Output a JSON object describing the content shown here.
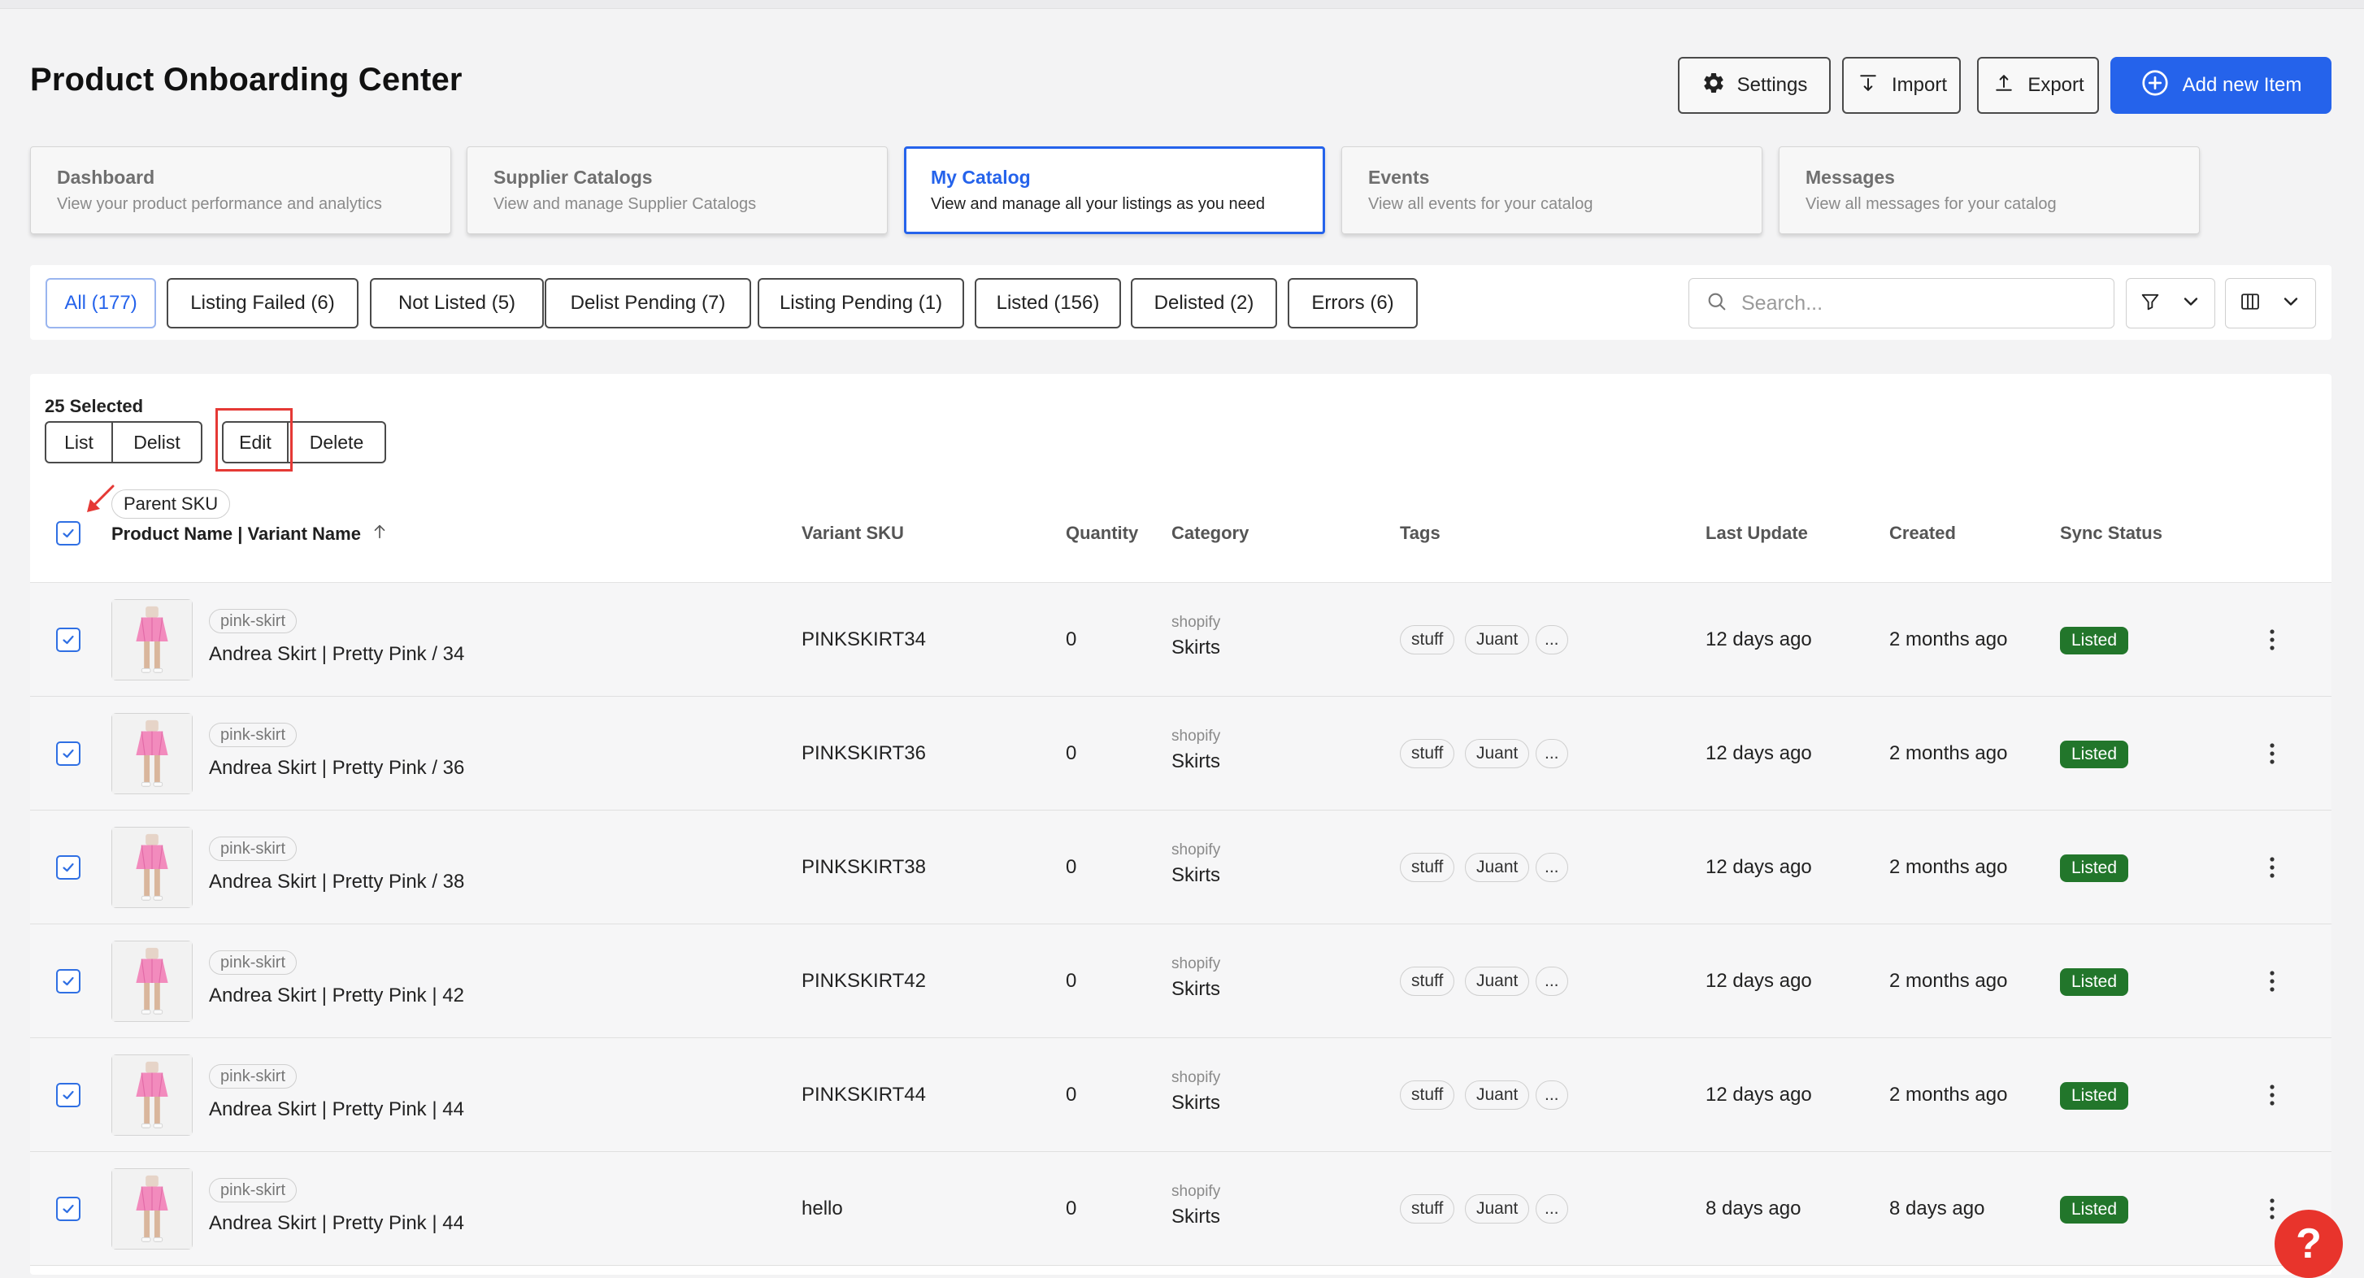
{
  "page_title": "Product Onboarding Center",
  "header": {
    "settings": "Settings",
    "import": "Import",
    "export": "Export",
    "add_new_item": "Add new Item"
  },
  "nav_cards": [
    {
      "title": "Dashboard",
      "subtitle": "View your product performance and analytics"
    },
    {
      "title": "Supplier Catalogs",
      "subtitle": "View and manage Supplier Catalogs"
    },
    {
      "title": "My Catalog",
      "subtitle": "View and manage all your listings as you need"
    },
    {
      "title": "Events",
      "subtitle": "View all events for your catalog"
    },
    {
      "title": "Messages",
      "subtitle": "View all messages for your catalog"
    }
  ],
  "filters": [
    {
      "label": "All (177)",
      "active": true
    },
    {
      "label": "Listing Failed (6)"
    },
    {
      "label": "Not Listed (5)"
    },
    {
      "label": "Delist Pending (7)"
    },
    {
      "label": "Listing Pending (1)"
    },
    {
      "label": "Listed (156)"
    },
    {
      "label": "Delisted (2)"
    },
    {
      "label": "Errors (6)"
    }
  ],
  "search": {
    "placeholder": "Search..."
  },
  "bulk": {
    "selected": "25 Selected",
    "list": "List",
    "delist": "Delist",
    "edit": "Edit",
    "delete": "Delete"
  },
  "columns": {
    "parent_sku": "Parent SKU",
    "product": "Product Name | Variant Name",
    "variant_sku": "Variant SKU",
    "quantity": "Quantity",
    "category": "Category",
    "tags": "Tags",
    "last_update": "Last Update",
    "created": "Created",
    "sync_status": "Sync Status"
  },
  "rows": [
    {
      "parent_sku": "pink-skirt",
      "name": "Andrea Skirt | Pretty Pink / 34",
      "variant_sku": "PINKSKIRT34",
      "quantity": "0",
      "category_source": "shopify",
      "category": "Skirts",
      "tags": [
        "stuff",
        "Juant",
        "..."
      ],
      "last_update": "12 days ago",
      "created": "2 months ago",
      "status": "Listed"
    },
    {
      "parent_sku": "pink-skirt",
      "name": "Andrea Skirt | Pretty Pink / 36",
      "variant_sku": "PINKSKIRT36",
      "quantity": "0",
      "category_source": "shopify",
      "category": "Skirts",
      "tags": [
        "stuff",
        "Juant",
        "..."
      ],
      "last_update": "12 days ago",
      "created": "2 months ago",
      "status": "Listed"
    },
    {
      "parent_sku": "pink-skirt",
      "name": "Andrea Skirt | Pretty Pink / 38",
      "variant_sku": "PINKSKIRT38",
      "quantity": "0",
      "category_source": "shopify",
      "category": "Skirts",
      "tags": [
        "stuff",
        "Juant",
        "..."
      ],
      "last_update": "12 days ago",
      "created": "2 months ago",
      "status": "Listed"
    },
    {
      "parent_sku": "pink-skirt",
      "name": "Andrea Skirt | Pretty Pink | 42",
      "variant_sku": "PINKSKIRT42",
      "quantity": "0",
      "category_source": "shopify",
      "category": "Skirts",
      "tags": [
        "stuff",
        "Juant",
        "..."
      ],
      "last_update": "12 days ago",
      "created": "2 months ago",
      "status": "Listed"
    },
    {
      "parent_sku": "pink-skirt",
      "name": "Andrea Skirt | Pretty Pink | 44",
      "variant_sku": "PINKSKIRT44",
      "quantity": "0",
      "category_source": "shopify",
      "category": "Skirts",
      "tags": [
        "stuff",
        "Juant",
        "..."
      ],
      "last_update": "12 days ago",
      "created": "2 months ago",
      "status": "Listed"
    },
    {
      "parent_sku": "pink-skirt",
      "name": "Andrea Skirt | Pretty Pink | 44",
      "variant_sku": "hello",
      "quantity": "0",
      "category_source": "shopify",
      "category": "Skirts",
      "tags": [
        "stuff",
        "Juant",
        "..."
      ],
      "last_update": "8 days ago",
      "created": "8 days ago",
      "status": "Listed"
    }
  ],
  "help": {
    "label": "?"
  },
  "icons": {
    "settings": "gear-icon",
    "import": "import-icon",
    "export": "export-icon",
    "add": "plus-circle-icon",
    "search": "search-icon",
    "filter": "filter-icon",
    "columns": "columns-icon",
    "sort": "arrow-up-icon",
    "row_menu": "kebab-menu-icon",
    "help": "help-icon"
  },
  "colors": {
    "accent": "#2563eb",
    "listed_badge": "#22762b",
    "annotation_red": "#e53935",
    "help_button": "#e8342c"
  }
}
